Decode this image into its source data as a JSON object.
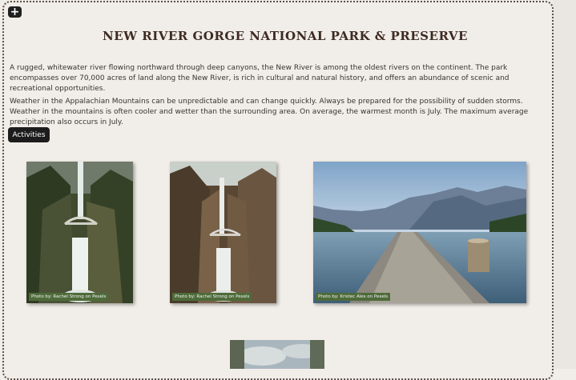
{
  "page": {
    "title": "New River Gorge National Park & Preserve",
    "paragraphs": [
      "A rugged, whitewater river flowing northward through deep canyons, the New River is among the oldest rivers on the continent. The park encompasses over 70,000 acres of land along the New River, is rich in cultural and natural history, and offers an abundance of scenic and recreational opportunities.",
      "Weather in the Appalachian Mountains can be unpredictable and can change quickly. Always be prepared for the possibility of sudden storms. Weather in the mountains is often cooler and wetter than the surrounding area. On average, the warmest month is July. The maximum average precipitation also occurs in July."
    ],
    "activities_label": "Activities",
    "add_icon_glyph": "+"
  },
  "photos": [
    {
      "credit": "Photo by: Rachel Strong on Pexels",
      "subject": "waterfall with bridge"
    },
    {
      "credit": "Photo by: Rachel Strong on Pexels",
      "subject": "waterfall with bridge"
    },
    {
      "credit": "Photo by: Kristec Ales on Pexels",
      "subject": "lake dock with mountains"
    },
    {
      "credit": "",
      "subject": "sky and trees"
    }
  ],
  "colors": {
    "background": "#f1ede8",
    "title": "#3d2b22",
    "credit_badge": "#4e6b3a",
    "button": "#1c1c1c"
  }
}
